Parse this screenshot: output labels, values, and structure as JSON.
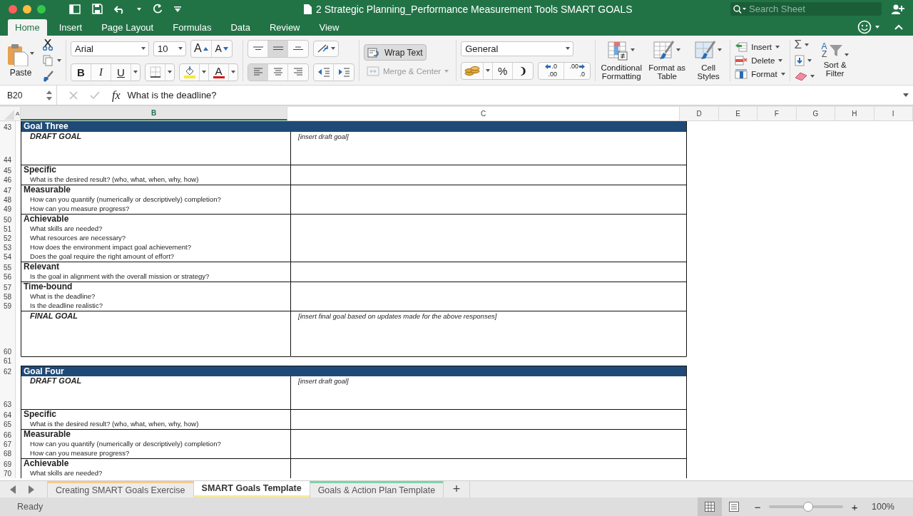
{
  "window": {
    "title": "2 Strategic Planning_Performance Measurement Tools SMART GOALS"
  },
  "search": {
    "placeholder": "Search Sheet"
  },
  "ribbon_tabs": [
    {
      "label": "Home",
      "selected": true
    },
    {
      "label": "Insert",
      "selected": false
    },
    {
      "label": "Page Layout",
      "selected": false
    },
    {
      "label": "Formulas",
      "selected": false
    },
    {
      "label": "Data",
      "selected": false
    },
    {
      "label": "Review",
      "selected": false
    },
    {
      "label": "View",
      "selected": false
    }
  ],
  "ribbon": {
    "paste": "Paste",
    "font": "Arial",
    "font_size": "10",
    "grow_font": "A",
    "shrink_font": "A",
    "bold": "B",
    "italic": "I",
    "underline": "U",
    "font_color": "A",
    "vertical_align": [
      {
        "kind": "top",
        "on": false
      },
      {
        "kind": "middle",
        "on": true
      },
      {
        "kind": "bottom",
        "on": false
      }
    ],
    "horizontal_align": [
      {
        "kind": "left",
        "on": true
      },
      {
        "kind": "center",
        "on": false
      },
      {
        "kind": "right",
        "on": false
      }
    ],
    "wrap_text": {
      "label": "Wrap Text",
      "on": true
    },
    "merge_center": {
      "label": "Merge & Center",
      "disabled": true
    },
    "number_format": "General",
    "percent": "%",
    "comma": "❩",
    "increase_decimal": [
      ".0",
      ".00"
    ],
    "decrease_decimal": [
      ".00",
      ".0"
    ],
    "conditional_formatting": "Conditional Formatting",
    "format_as_table": "Format as Table",
    "cell_styles": "Cell Styles",
    "insert": "Insert",
    "delete": "Delete",
    "format": "Format",
    "autosum": "Σ",
    "sort_letters": [
      "A",
      "Z"
    ],
    "sort_filter": "Sort & Filter"
  },
  "formula_bar": {
    "name_box": "B20",
    "function_label": "fx",
    "formula": "What is the deadline?"
  },
  "columns": [
    {
      "label": "A",
      "selected": false
    },
    {
      "label": "B",
      "selected": true
    },
    {
      "label": "C",
      "selected": false
    },
    {
      "label": "D",
      "selected": false
    },
    {
      "label": "E",
      "selected": false
    },
    {
      "label": "F",
      "selected": false
    },
    {
      "label": "G",
      "selected": false
    },
    {
      "label": "H",
      "selected": false
    },
    {
      "label": "I",
      "selected": false
    }
  ],
  "rows": [
    {
      "number": "43",
      "kind": "goal",
      "text": "Goal Three"
    },
    {
      "number": "44",
      "kind": "draft",
      "text": "DRAFT GOAL",
      "note": "[insert draft goal]"
    },
    {
      "number": "45",
      "kind": "section",
      "text": "Specific"
    },
    {
      "number": "46",
      "kind": "question",
      "text": "What is the desired result? (who, what, when, why, how)"
    },
    {
      "number": "47",
      "kind": "section",
      "text": "Measurable"
    },
    {
      "number": "48",
      "kind": "question",
      "text": "How can you quantify (numerically or descriptively) completion?"
    },
    {
      "number": "49",
      "kind": "question",
      "text": "How can you measure progress?"
    },
    {
      "number": "50",
      "kind": "section",
      "text": "Achievable"
    },
    {
      "number": "51",
      "kind": "question",
      "text": "What skills are needed?"
    },
    {
      "number": "52",
      "kind": "question",
      "text": "What resources are necessary?"
    },
    {
      "number": "53",
      "kind": "question",
      "text": "How does the environment impact goal achievement?"
    },
    {
      "number": "54",
      "kind": "question",
      "text": "Does the goal require the right amount of effort?"
    },
    {
      "number": "55",
      "kind": "section",
      "text": "Relevant"
    },
    {
      "number": "56",
      "kind": "question",
      "text": "Is the goal in alignment with the overall mission or strategy?"
    },
    {
      "number": "57",
      "kind": "section",
      "text": "Time-bound"
    },
    {
      "number": "58",
      "kind": "question",
      "text": "What is the deadline?"
    },
    {
      "number": "59",
      "kind": "question",
      "text": "Is the deadline realistic?"
    },
    {
      "number": "60",
      "kind": "final",
      "text": "FINAL GOAL",
      "note": "[insert final goal based on updates made for the above responses]"
    },
    {
      "number": "61",
      "kind": "blank"
    },
    {
      "number": "62",
      "kind": "goal",
      "text": "Goal Four"
    },
    {
      "number": "63",
      "kind": "draft",
      "text": "DRAFT GOAL",
      "note": "[insert draft goal]"
    },
    {
      "number": "64",
      "kind": "section",
      "text": "Specific"
    },
    {
      "number": "65",
      "kind": "question",
      "text": "What is the desired result? (who, what, when, why, how)"
    },
    {
      "number": "66",
      "kind": "section",
      "text": "Measurable"
    },
    {
      "number": "67",
      "kind": "question",
      "text": "How can you quantify (numerically or descriptively) completion?"
    },
    {
      "number": "68",
      "kind": "question",
      "text": "How can you measure progress?"
    },
    {
      "number": "69",
      "kind": "section",
      "text": "Achievable"
    },
    {
      "number": "70",
      "kind": "question",
      "text": "What skills are needed?"
    }
  ],
  "sheet_tabs": [
    {
      "label": "Creating SMART Goals Exercise",
      "selected": false,
      "color": "#f7c98a"
    },
    {
      "label": "SMART Goals Template",
      "selected": true,
      "color": "#f2ec9a"
    },
    {
      "label": "Goals & Action Plan Template",
      "selected": false,
      "color": "#7fd3a8"
    }
  ],
  "add_sheet": "+",
  "status_bar": {
    "status": "Ready",
    "zoom_out": "−",
    "zoom_in": "+",
    "zoom": "100%",
    "level": 0.53
  }
}
